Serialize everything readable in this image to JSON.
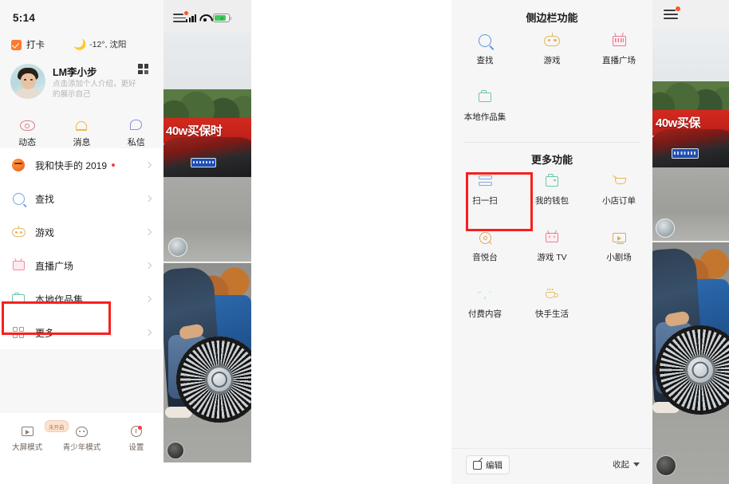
{
  "left_phone": {
    "status_bar": {
      "time": "5:14",
      "signal_icon": "cellular-signal-icon",
      "wifi_icon": "wifi-icon",
      "battery_icon": "battery-charging-icon"
    },
    "checkin": {
      "label": "打卡",
      "icon": "checkin-checkbox-icon"
    },
    "weather": {
      "icon": "moon-icon",
      "text": "-12°, 沈阳"
    },
    "profile": {
      "avatar_icon": "user-avatar",
      "name": "LM李小步",
      "qr_icon": "qr-code-icon",
      "bio": "点击添加个人介绍，更好的展示自己"
    },
    "actions": [
      {
        "label": "动态",
        "icon": "eye-icon"
      },
      {
        "label": "消息",
        "icon": "bell-icon"
      },
      {
        "label": "私信",
        "icon": "chat-bubble-icon"
      }
    ],
    "menu_items": [
      {
        "label": "我和快手的 2019",
        "icon": "pumpkin-icon",
        "has_dot": true
      },
      {
        "label": "查找",
        "icon": "search-icon",
        "has_dot": false
      },
      {
        "label": "游戏",
        "icon": "game-robot-icon",
        "has_dot": false
      },
      {
        "label": "直播广场",
        "icon": "live-tv-icon",
        "has_dot": false
      },
      {
        "label": "本地作品集",
        "icon": "folder-icon",
        "has_dot": false
      },
      {
        "label": "更多",
        "icon": "grid-icon",
        "has_dot": false
      }
    ],
    "bottom_bar": [
      {
        "label": "大屏模式",
        "icon": "big-screen-icon",
        "badge": "未开启"
      },
      {
        "label": "青少年模式",
        "icon": "teen-mode-icon",
        "badge": ""
      },
      {
        "label": "设置",
        "icon": "gear-icon",
        "badge": ""
      }
    ],
    "video_feed": {
      "menu_icon": "hamburger-menu-icon",
      "video1_caption": "40w买保时",
      "video1_thumb": "video-author-avatar",
      "video2_thumb": "video-author-avatar"
    }
  },
  "right_phone": {
    "sidebar_section": {
      "title": "侧边栏功能",
      "items": [
        {
          "label": "查找",
          "icon": "search-icon"
        },
        {
          "label": "游戏",
          "icon": "game-robot-icon"
        },
        {
          "label": "直播广场",
          "icon": "live-tv-icon"
        },
        {
          "label": "本地作品集",
          "icon": "folder-icon"
        }
      ]
    },
    "more_section": {
      "title": "更多功能",
      "items": [
        {
          "label": "扫一扫",
          "icon": "scan-icon"
        },
        {
          "label": "我的钱包",
          "icon": "wallet-icon"
        },
        {
          "label": "小店订单",
          "icon": "shopping-cart-icon"
        },
        {
          "label": "音悦台",
          "icon": "music-disc-icon"
        },
        {
          "label": "游戏 TV",
          "icon": "game-tv-icon"
        },
        {
          "label": "小剧场",
          "icon": "theater-screen-icon"
        },
        {
          "label": "付费内容",
          "icon": "diamond-icon"
        },
        {
          "label": "快手生活",
          "icon": "coffee-cup-icon"
        }
      ]
    },
    "bottom_bar": {
      "edit_label": "编辑",
      "edit_icon": "edit-pencil-icon",
      "collapse_label": "收起",
      "collapse_icon": "chevron-down-icon"
    },
    "video_feed": {
      "menu_icon": "hamburger-menu-icon",
      "video1_caption": "40w买保",
      "video1_thumb": "video-author-avatar",
      "video2_thumb": "video-author-avatar"
    }
  },
  "highlights": {
    "accent_color": "#fa1e1e",
    "more_box_target": "更多",
    "scan_box_target": "扫一扫"
  }
}
